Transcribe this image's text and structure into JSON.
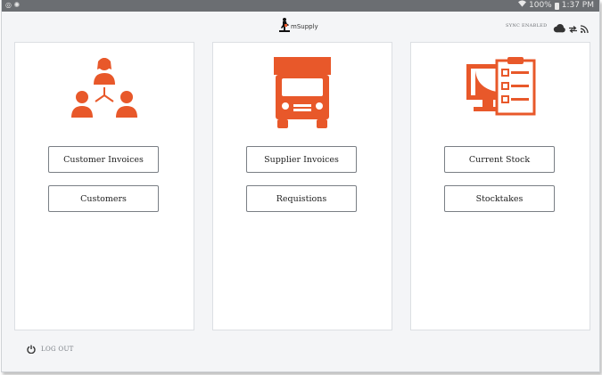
{
  "status_bar": {
    "battery": "100%",
    "time": "1:37 PM"
  },
  "header": {
    "app_name": "mSupply",
    "sync_status": "SYNC ENABLED"
  },
  "cards": [
    {
      "icon": "people-network-icon",
      "buttons": [
        "Customer Invoices",
        "Customers"
      ]
    },
    {
      "icon": "truck-icon",
      "buttons": [
        "Supplier Invoices",
        "Requistions"
      ]
    },
    {
      "icon": "stock-clipboard-icon",
      "buttons": [
        "Current Stock",
        "Stocktakes"
      ]
    }
  ],
  "footer": {
    "logout_label": "LOG OUT"
  },
  "colors": {
    "accent": "#e8582a",
    "status_bar": "#6b6e72",
    "background": "#f4f5f7"
  }
}
